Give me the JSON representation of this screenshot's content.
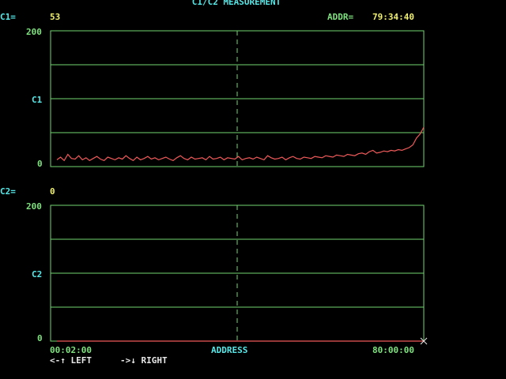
{
  "header": {
    "title": "C1/C2 MEASUREMENT",
    "c1_label": "C1=",
    "c1_value": "53",
    "addr_label": "ADDR=",
    "addr_value": "79:34:40"
  },
  "chart_top": {
    "y_max_label": "200",
    "y_mid_label": "C1",
    "y_min_label": "0"
  },
  "c2_row": {
    "label": "C2=",
    "value": "0"
  },
  "chart_bottom": {
    "y_max_label": "200",
    "y_mid_label": "C2",
    "y_min_label": "0"
  },
  "x_axis": {
    "start_label": "00:02:00",
    "center_label": "ADDRESS",
    "end_label": "80:00:00"
  },
  "nav_help": {
    "left": "<-↑ LEFT",
    "right": "->↓ RIGHT"
  },
  "colors": {
    "background": "#000000",
    "grid": "#6fd66f",
    "trace": "#f05a5a",
    "label_cyan": "#55e8e8",
    "label_green": "#7ee27e",
    "value_yellow": "#f0f070"
  },
  "chart_data": [
    {
      "type": "line",
      "xlabel": "ADDRESS",
      "ylabel": "C1",
      "ylim": [
        0,
        200
      ],
      "x_range": [
        "00:02:00",
        "80:00:00"
      ],
      "series": [
        {
          "values": [
            10,
            14,
            9,
            18,
            12,
            11,
            16,
            10,
            13,
            9,
            12,
            15,
            11,
            9,
            14,
            12,
            10,
            13,
            11,
            16,
            12,
            9,
            14,
            10,
            12,
            15,
            11,
            13,
            10,
            12,
            14,
            11,
            9,
            13,
            16,
            12,
            10,
            14,
            11,
            12,
            13,
            10,
            15,
            11,
            12,
            14,
            10,
            13,
            12,
            11,
            15,
            10,
            12,
            13,
            11,
            14,
            12,
            10,
            16,
            13,
            11,
            12,
            14,
            10,
            13,
            15,
            12,
            11,
            14,
            13,
            12,
            15,
            14,
            13,
            16,
            15,
            14,
            17,
            16,
            15,
            18,
            17,
            16,
            19,
            20,
            18,
            22,
            24,
            20,
            21,
            23,
            22,
            24,
            23,
            25,
            24,
            26,
            28,
            32,
            42,
            48,
            58
          ]
        }
      ]
    },
    {
      "type": "line",
      "xlabel": "ADDRESS",
      "ylabel": "C2",
      "ylim": [
        0,
        200
      ],
      "x_range": [
        "00:02:00",
        "80:00:00"
      ],
      "series": [
        {
          "values": [
            0,
            0,
            0,
            0,
            0,
            0,
            0,
            0,
            0,
            0,
            0,
            0,
            0,
            0,
            0,
            0,
            0,
            0,
            0,
            0,
            0,
            0,
            0,
            0,
            0,
            0,
            0,
            0,
            0,
            0,
            0,
            0,
            0,
            0,
            0,
            0,
            0,
            0,
            0,
            0,
            0,
            0,
            0,
            0,
            0,
            0,
            0,
            0,
            0,
            0,
            0,
            0,
            0,
            0,
            0,
            0,
            0,
            0,
            0,
            0,
            0,
            0,
            0,
            0,
            0,
            0,
            0,
            0,
            0,
            0,
            0,
            0,
            0,
            0,
            0,
            0,
            0,
            0,
            0,
            0,
            0,
            0,
            0,
            0,
            0,
            0,
            0,
            0,
            0,
            0,
            0,
            0,
            0,
            0,
            0,
            0,
            0,
            0,
            0,
            0,
            0,
            0
          ]
        }
      ]
    }
  ]
}
